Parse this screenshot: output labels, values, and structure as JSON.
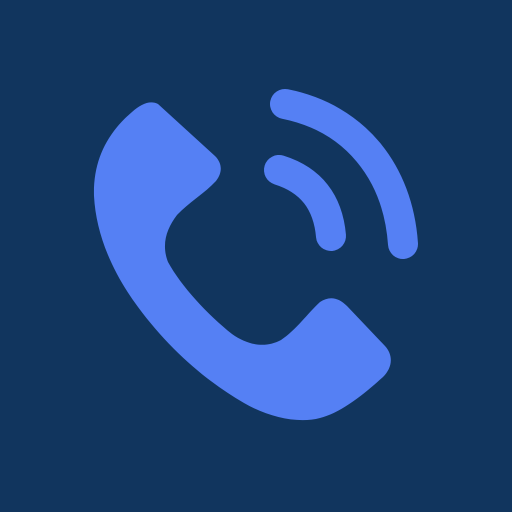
{
  "icon": {
    "name": "phone-call-icon",
    "background_color": "#11355E",
    "foreground_color": "#5580F4",
    "signal_wave_count": 2
  }
}
